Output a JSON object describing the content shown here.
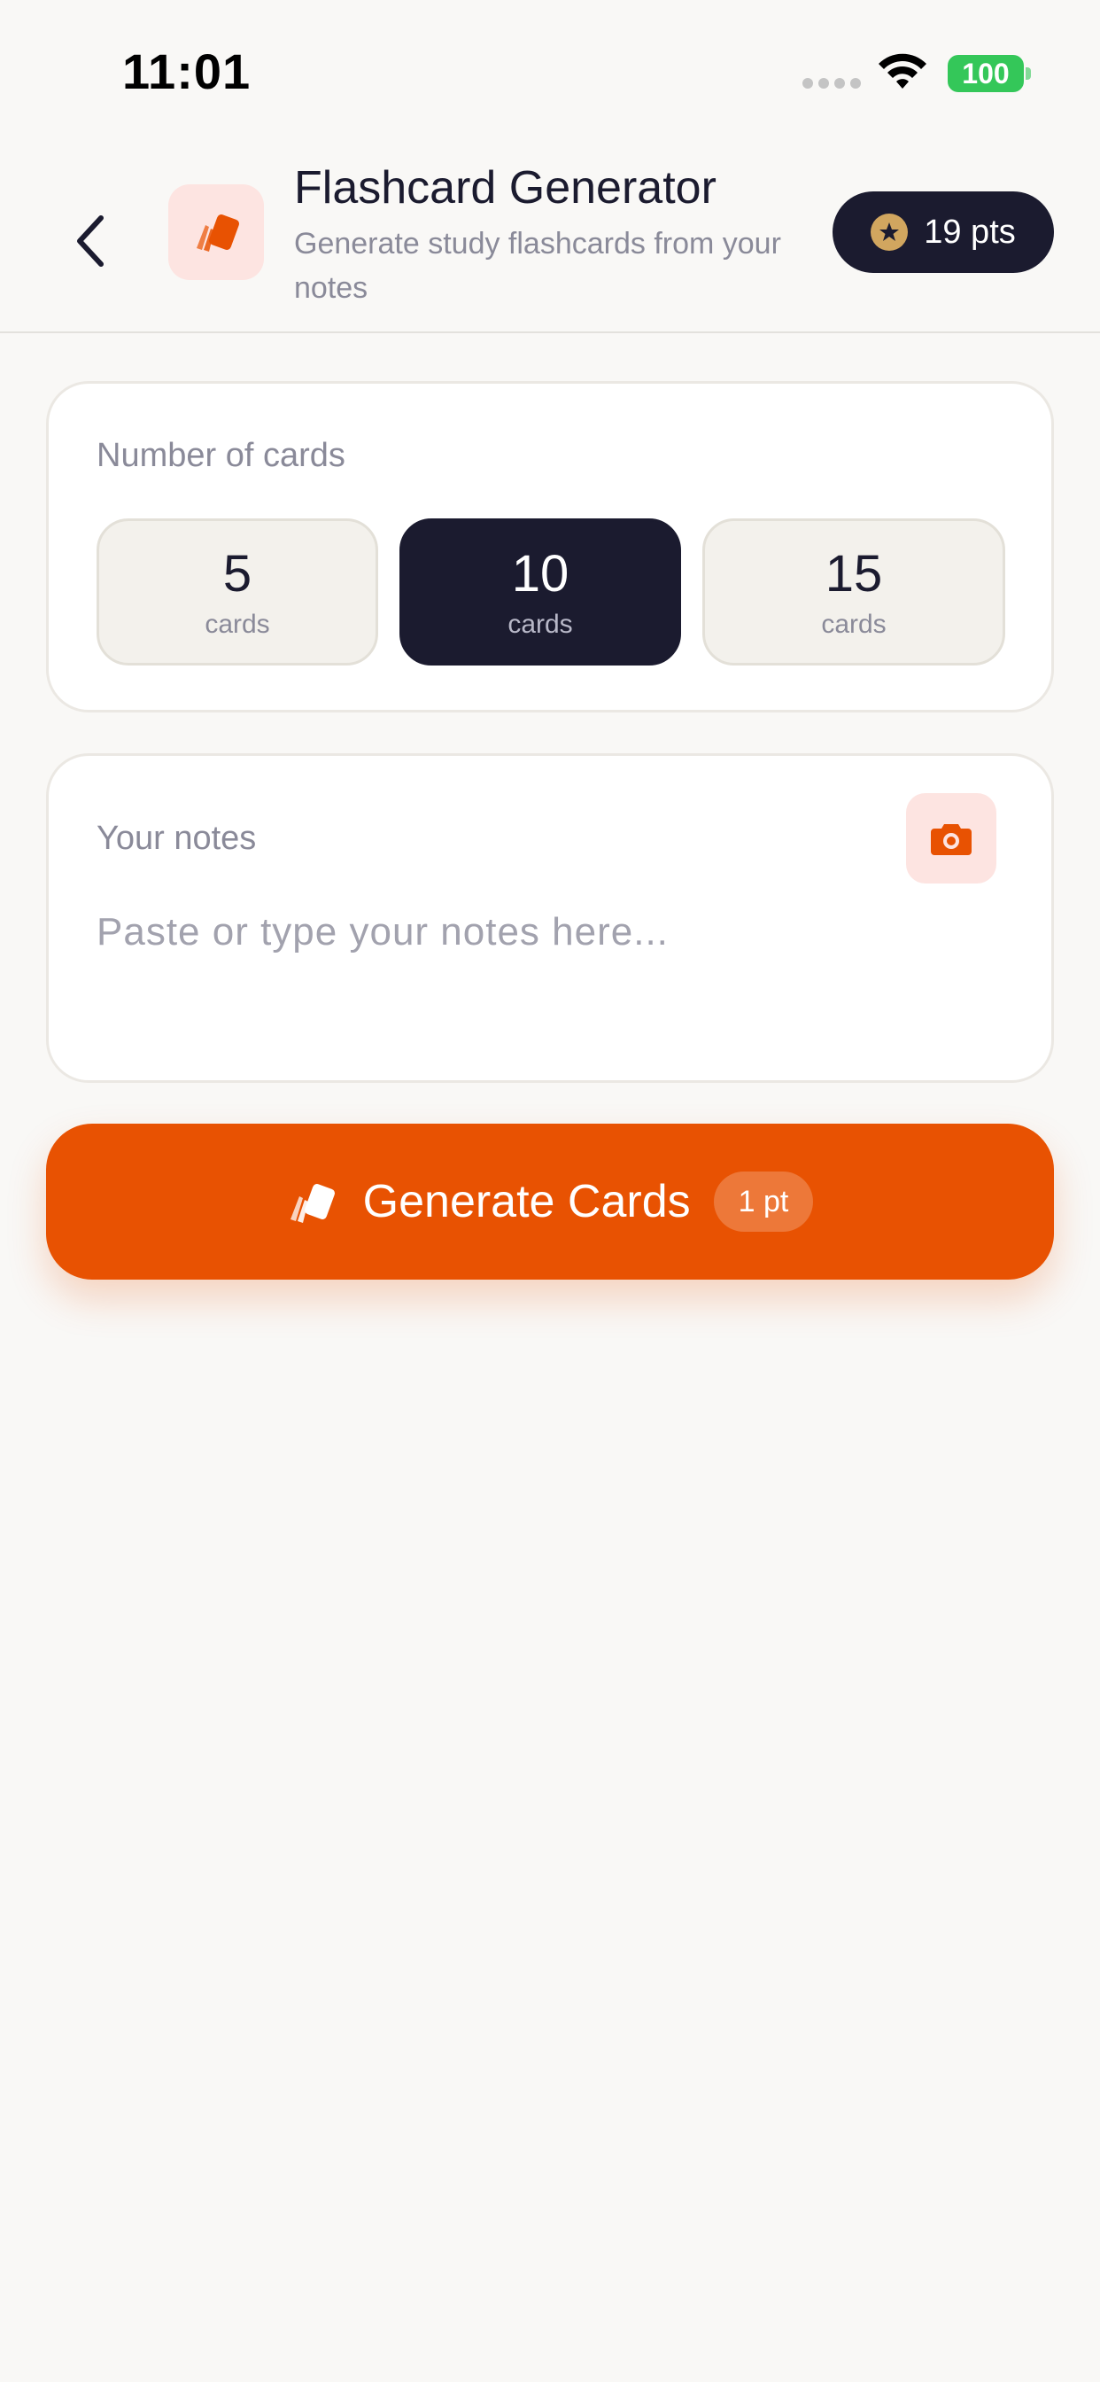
{
  "status_bar": {
    "time": "11:01",
    "battery": "100"
  },
  "header": {
    "title": "Flashcard Generator",
    "subtitle": "Generate study flashcards from your notes",
    "points": "19 pts",
    "back_icon": "chevron-left-icon",
    "app_icon": "flashcards-icon",
    "points_icon": "star-icon"
  },
  "card_count": {
    "label": "Number of cards",
    "selected": "10",
    "options": [
      {
        "value": "5",
        "unit": "cards"
      },
      {
        "value": "10",
        "unit": "cards"
      },
      {
        "value": "15",
        "unit": "cards"
      }
    ]
  },
  "notes": {
    "label": "Your notes",
    "placeholder": "Paste or type your notes here...",
    "value": "",
    "camera_icon": "camera-icon"
  },
  "generate": {
    "label": "Generate Cards",
    "cost": "1 pt",
    "icon": "flashcards-icon"
  },
  "colors": {
    "accent": "#e85202",
    "dark": "#1b1b2f",
    "accent_soft": "#fde4e1",
    "star": "#d1a65f",
    "battery": "#34c759"
  }
}
